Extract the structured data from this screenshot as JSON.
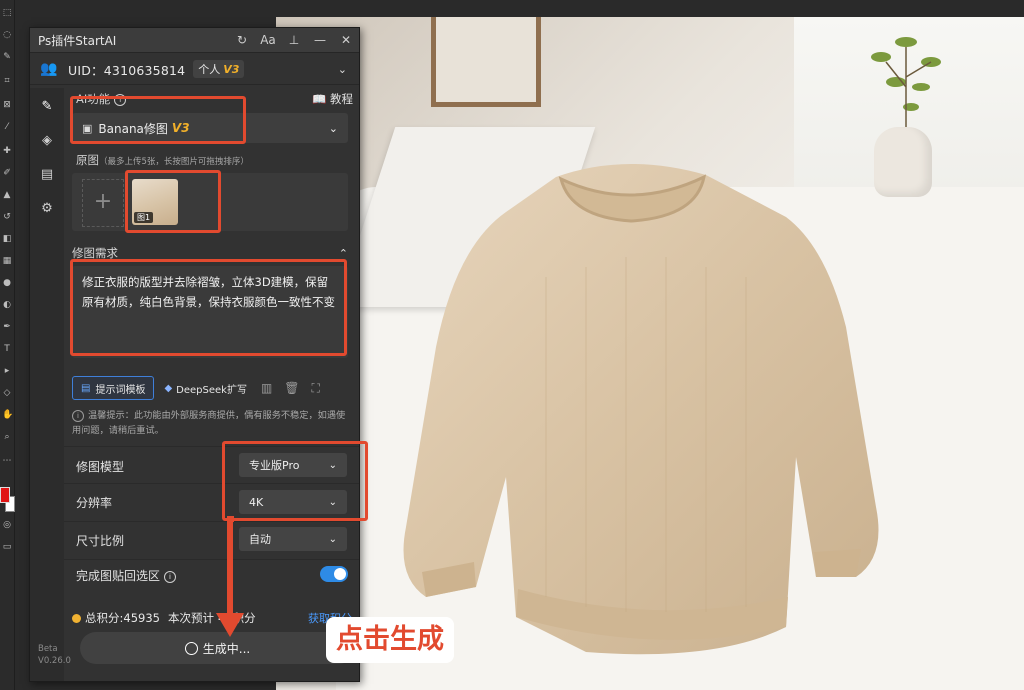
{
  "plugin": {
    "title": "Ps插件StartAI",
    "version_tag": "Beta",
    "version": "V0.26.0"
  },
  "user": {
    "uid_text": "UID：4310635814",
    "plan": "个人",
    "plan_version": "V3"
  },
  "ai_feature": {
    "label": "AI功能",
    "tutorial": "教程",
    "selected": "Banana修图",
    "selected_version": "V3"
  },
  "source": {
    "label": "原图",
    "hint": "（最多上传5张，长按图片可拖拽排序）",
    "thumb_tag": "图1"
  },
  "requirement": {
    "label": "修图需求",
    "text": "修正衣服的版型并去除褶皱，立体3D建模，保留原有材质，纯白色背景，保持衣服颜色一致性不变",
    "template_button": "提示词模板",
    "deepseek_button": "DeepSeek扩写"
  },
  "notice": "温馨提示：此功能由外部服务商提供，偶有服务不稳定，如遇使用问题，请稍后重试。",
  "settings": {
    "model_label": "修图模型",
    "model_value": "专业版Pro",
    "resolution_label": "分辨率",
    "resolution_value": "4K",
    "ratio_label": "尺寸比例",
    "ratio_value": "自动",
    "paste_back_label": "完成图贴回选区",
    "paste_back_on": true
  },
  "points": {
    "total": "总积分:45935",
    "estimate": "本次预计",
    "estimate_cost": "40积分",
    "get_points": "获取积分"
  },
  "generate_button": "生成中...",
  "annotation": {
    "callout": "点击生成",
    "color": "#e24a2f"
  },
  "colors": {
    "accent": "#2e8be6",
    "version_gold": "#f1b02a",
    "link": "#4a9bff"
  }
}
